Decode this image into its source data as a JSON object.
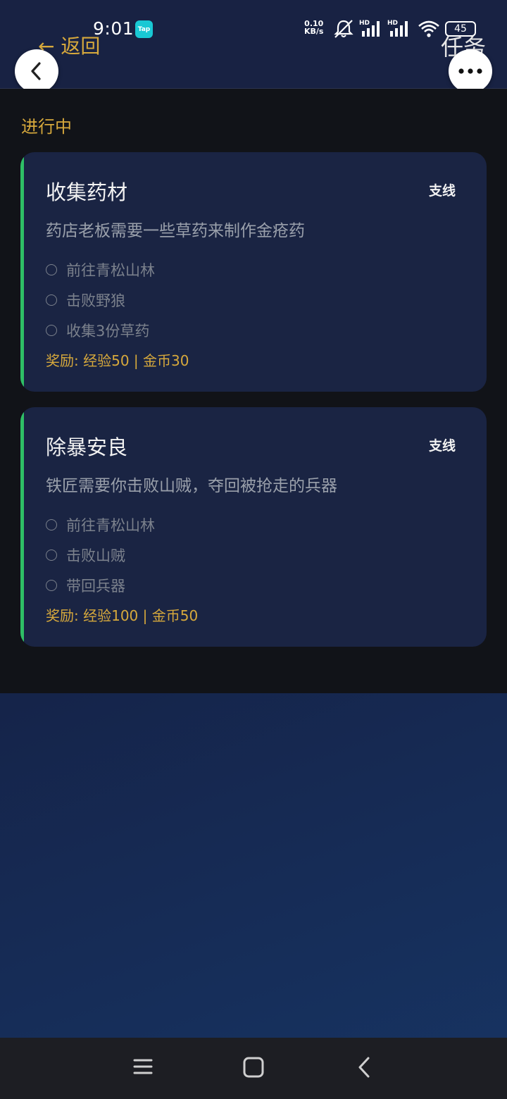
{
  "status_bar": {
    "time": "9:01",
    "tap_badge": "Tap",
    "net_speed_top": "0.10",
    "net_speed_bottom": "KB/s",
    "signal_label_1": "HD",
    "signal_label_2": "HD",
    "battery": "45",
    "icons": [
      "mute-icon",
      "signal-icon",
      "signal-icon",
      "wifi-icon",
      "battery-icon"
    ]
  },
  "header": {
    "back_link": "← 返回",
    "title": "任务"
  },
  "section": {
    "label": "进行中"
  },
  "quests": [
    {
      "title": "收集药材",
      "tag": "支线",
      "description": "药店老板需要一些草药来制作金疮药",
      "objectives": [
        "前往青松山林",
        "击败野狼",
        "收集3份草药"
      ],
      "reward": "奖励: 经验50 | 金币30"
    },
    {
      "title": "除暴安良",
      "tag": "支线",
      "description": "铁匠需要你击败山贼，夺回被抢走的兵器",
      "objectives": [
        "前往青松山林",
        "击败山贼",
        "带回兵器"
      ],
      "reward": "奖励: 经验100 | 金币50"
    }
  ],
  "colors": {
    "accent_gold": "#d7a93c",
    "quest_green": "#2fbf66",
    "card_bg": "#1a2443"
  }
}
